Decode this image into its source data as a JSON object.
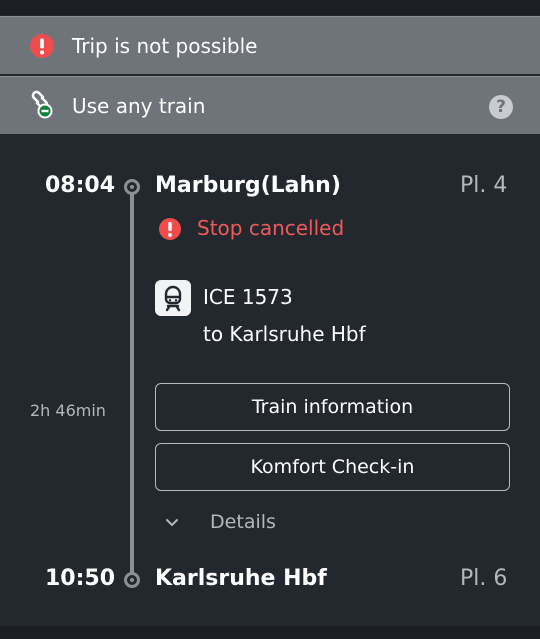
{
  "banners": {
    "trip": {
      "label": "Trip is not possible",
      "icon": "alert-icon"
    },
    "any_train": {
      "label": "Use any train",
      "icon": "link-minus-icon",
      "help": "?"
    }
  },
  "departure": {
    "time": "08:04",
    "station": "Marburg(Lahn)",
    "platform": "Pl. 4"
  },
  "status": {
    "text": "Stop cancelled",
    "color": "#ef5b5b"
  },
  "train": {
    "name": "ICE 1573",
    "destination": "to Karlsruhe Hbf",
    "icon": "train-icon"
  },
  "duration": "2h 46min",
  "buttons": {
    "info": "Train information",
    "checkin": "Komfort Check-in"
  },
  "details": {
    "label": "Details",
    "icon": "chevron-down-icon"
  },
  "arrival": {
    "time": "10:50",
    "station": "Karlsruhe Hbf",
    "platform": "Pl. 6"
  },
  "colors": {
    "banner": "#6f747a",
    "background": "#23272e",
    "alert": "#ef5b5b"
  }
}
